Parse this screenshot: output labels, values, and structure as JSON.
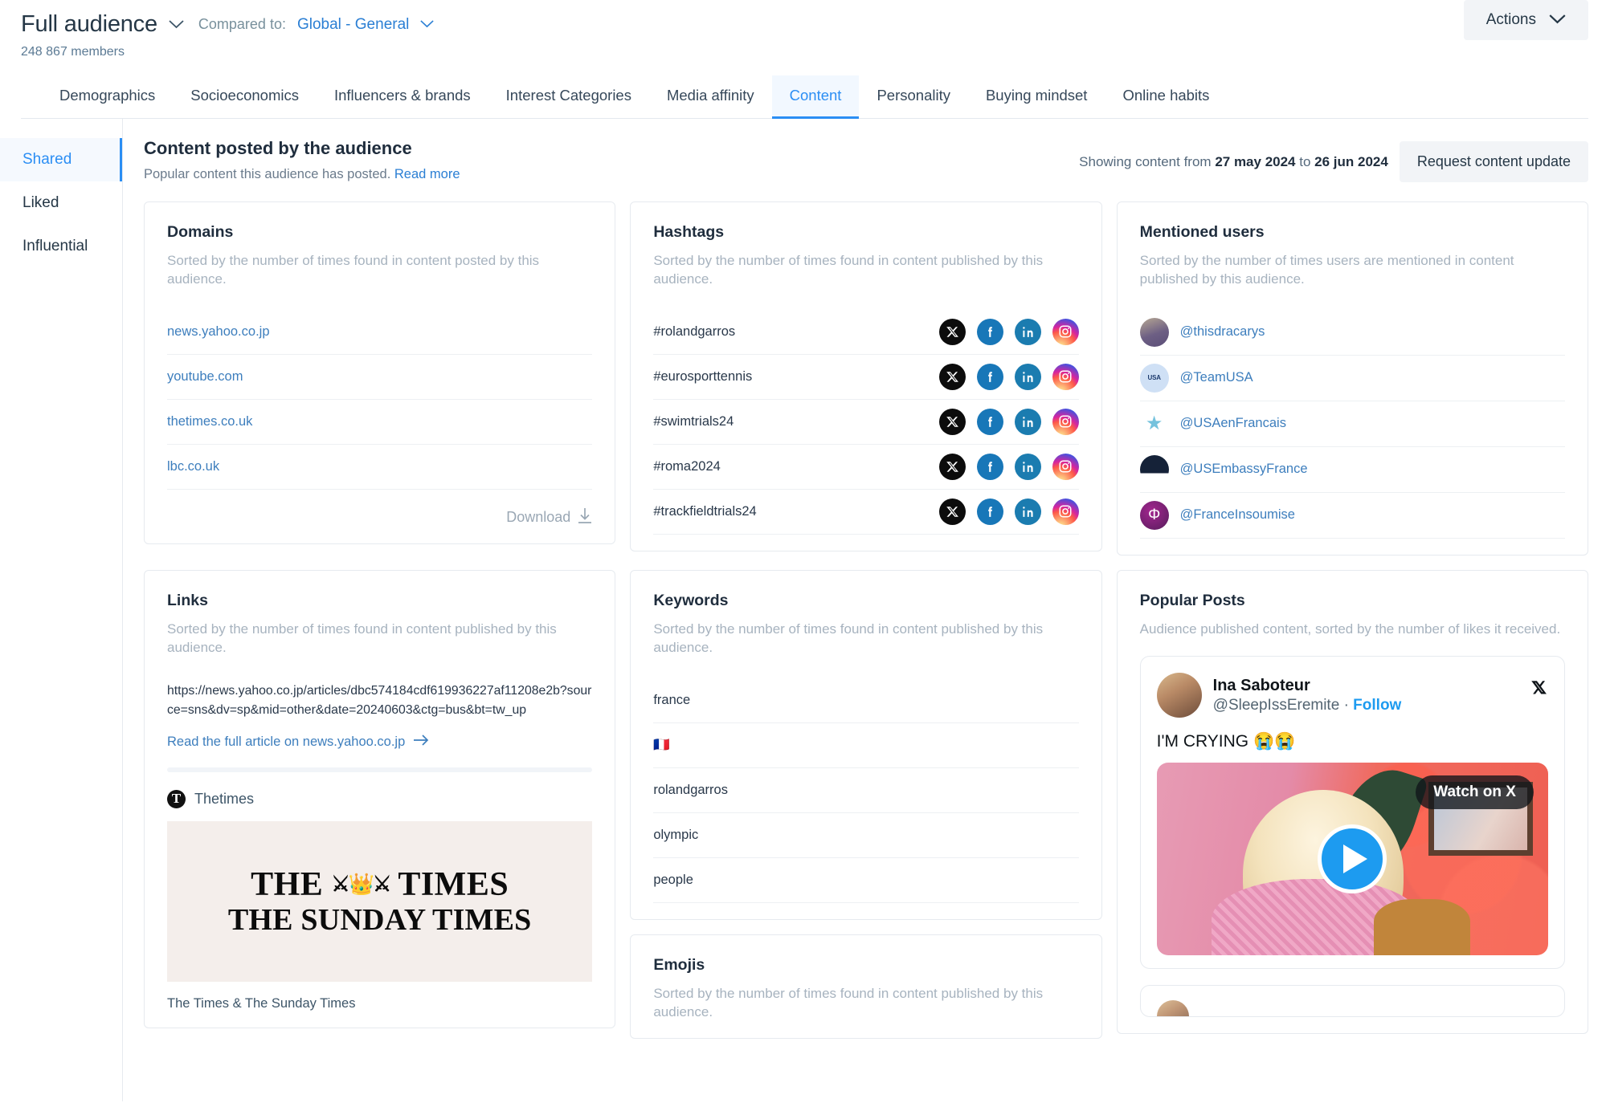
{
  "header": {
    "audience_title": "Full audience",
    "compared_label": "Compared to:",
    "compared_value": "Global - General",
    "members": "248 867 members",
    "actions_label": "Actions"
  },
  "tabs": [
    {
      "label": "Demographics",
      "active": false
    },
    {
      "label": "Socioeconomics",
      "active": false
    },
    {
      "label": "Influencers & brands",
      "active": false
    },
    {
      "label": "Interest Categories",
      "active": false
    },
    {
      "label": "Media affinity",
      "active": false
    },
    {
      "label": "Content",
      "active": true
    },
    {
      "label": "Personality",
      "active": false
    },
    {
      "label": "Buying mindset",
      "active": false
    },
    {
      "label": "Online habits",
      "active": false
    }
  ],
  "sidebar": {
    "items": [
      {
        "label": "Shared",
        "active": true
      },
      {
        "label": "Liked",
        "active": false
      },
      {
        "label": "Influential",
        "active": false
      }
    ]
  },
  "content_header": {
    "title": "Content posted by the audience",
    "subtitle": "Popular content this audience has posted.",
    "read_more": "Read more",
    "showing_prefix": "Showing content from",
    "date_from": "27 may 2024",
    "showing_mid": "to",
    "date_to": "26 jun 2024",
    "request_button": "Request content update"
  },
  "cards": {
    "domains": {
      "title": "Domains",
      "subtitle": "Sorted by the number of times found in content posted by this audience.",
      "items": [
        "news.yahoo.co.jp",
        "youtube.com",
        "thetimes.co.uk",
        "lbc.co.uk"
      ],
      "download_label": "Download"
    },
    "hashtags": {
      "title": "Hashtags",
      "subtitle": "Sorted by the number of times found in content published by this audience.",
      "items": [
        "#rolandgarros",
        "#eurosporttennis",
        "#swimtrials24",
        "#roma2024",
        "#trackfieldtrials24"
      ],
      "social_icons": [
        "x-icon",
        "facebook-icon",
        "linkedin-icon",
        "instagram-icon"
      ]
    },
    "mentioned_users": {
      "title": "Mentioned users",
      "subtitle": "Sorted by the number of times users are mentioned in content published by this audience.",
      "items": [
        {
          "handle": "@thisdracarys",
          "avatar": "photo-avatar"
        },
        {
          "handle": "@TeamUSA",
          "avatar": "team-usa-logo",
          "initials": "TEAM USA"
        },
        {
          "handle": "@USAenFrancais",
          "avatar": "us-seal-logo"
        },
        {
          "handle": "@USEmbassyFrance",
          "avatar": "us-embassy-logo"
        },
        {
          "handle": "@FranceInsoumise",
          "avatar": "france-insoumise-logo"
        }
      ]
    },
    "links": {
      "title": "Links",
      "subtitle": "Sorted by the number of times found in content published by this audience.",
      "url": "https://news.yahoo.co.jp/articles/dbc574184cdf619936227af11208e2b?source=sns&dv=sp&mid=other&date=20240603&ctg=bus&bt=tw_up",
      "read_article": "Read the full article on news.yahoo.co.jp",
      "source_name": "Thetimes",
      "source_badge": "T",
      "preview_line1": "THE",
      "preview_line1b": "TIMES",
      "preview_line2": "THE SUNDAY TIMES",
      "caption": "The Times & The Sunday Times"
    },
    "keywords": {
      "title": "Keywords",
      "subtitle": "Sorted by the number of times found in content published by this audience.",
      "items": [
        "france",
        "🇫🇷",
        "rolandgarros",
        "olympic",
        "people"
      ]
    },
    "emojis": {
      "title": "Emojis",
      "subtitle": "Sorted by the number of times found in content published by this audience."
    },
    "popular_posts": {
      "title": "Popular Posts",
      "subtitle": "Audience published content, sorted by the number of likes it received.",
      "post": {
        "author_name": "Ina Saboteur",
        "author_handle": "@SleepIssEremite",
        "separator": "·",
        "follow_label": "Follow",
        "platform_icon": "x-icon",
        "text": "I'M CRYING 😭😭",
        "watch_label": "Watch on X",
        "play_icon": "play-icon"
      }
    }
  },
  "colors": {
    "accent_blue": "#2b8ef4",
    "link_blue": "#3d7ebd",
    "text_dark": "#1f2d3d",
    "muted": "#a7b3bf",
    "x_black": "#0c0c0c",
    "facebook": "#1877b8",
    "linkedin": "#1b7cb0",
    "twitter_follow": "#1d9bf0"
  }
}
